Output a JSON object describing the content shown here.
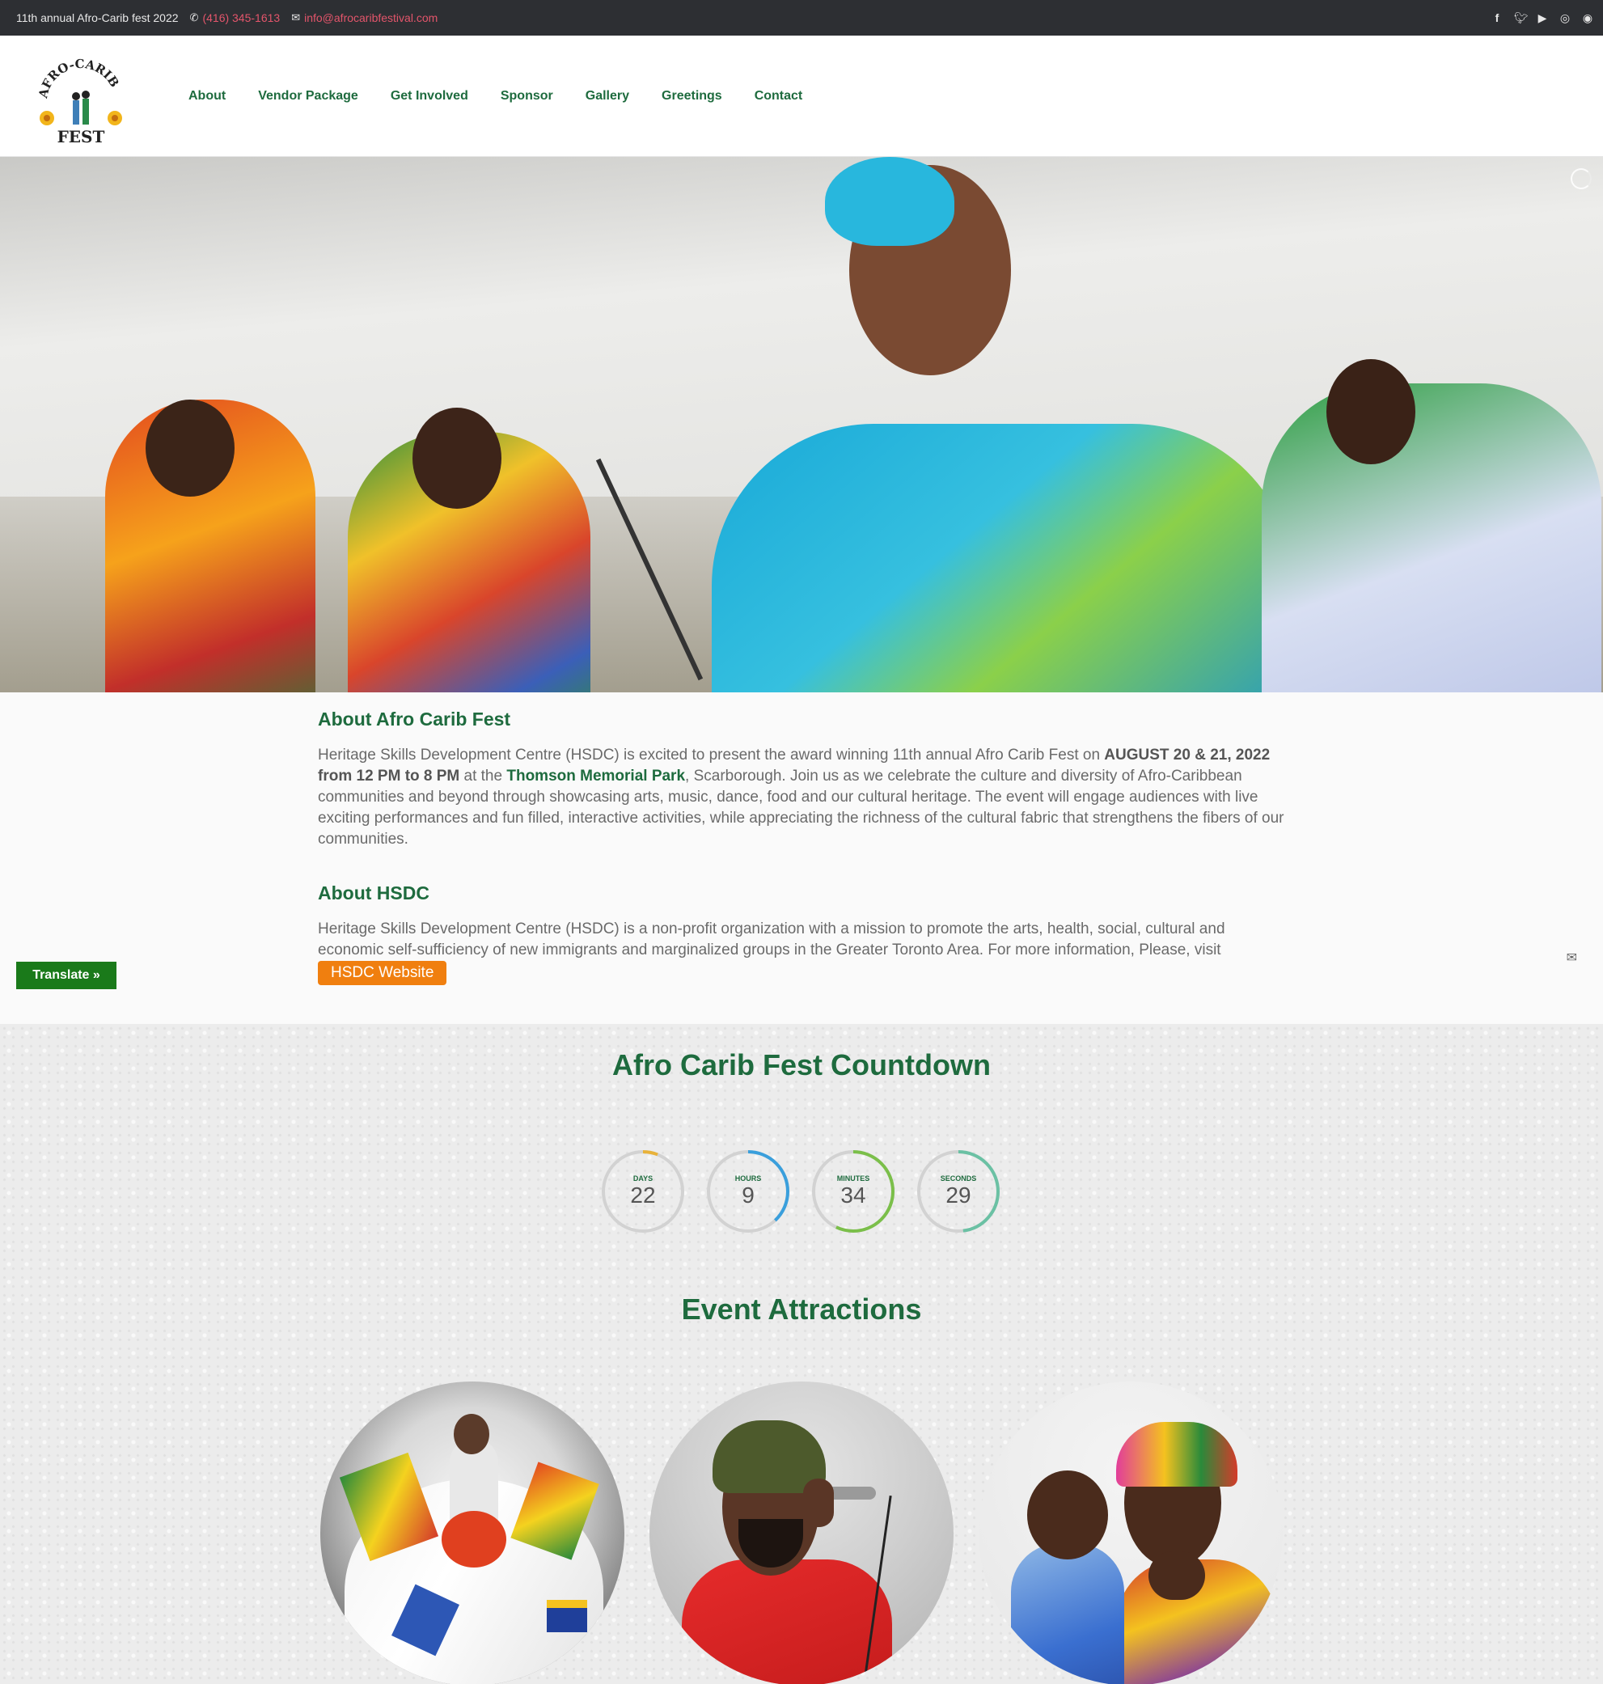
{
  "topbar": {
    "tagline": "11th annual Afro-Carib fest 2022",
    "phone": "(416) 345-1613",
    "email": "info@afrocaribfestival.com",
    "socials": [
      "facebook-icon",
      "twitter-icon",
      "youtube-icon",
      "instagram-icon",
      "globe-icon"
    ]
  },
  "logo": {
    "text_top": "AFRO-CARIB",
    "text_bottom": "FEST"
  },
  "nav": {
    "items": [
      "About",
      "Vendor Package",
      "Get Involved",
      "Sponsor",
      "Gallery",
      "Greetings",
      "Contact"
    ]
  },
  "hero": {
    "slide_count": 11,
    "active_slide": 7
  },
  "about": {
    "title": "About Afro Carib Fest",
    "p1_a": "Heritage Skills Development Centre (HSDC) is excited to present the award winning 11th annual Afro Carib Fest on ",
    "p1_date": "AUGUST 20 & 21, 2022 from 12 PM to 8 PM",
    "p1_b": " at the ",
    "p1_park": "Thomson Memorial Park",
    "p1_c": ", Scarborough. Join us as we celebrate the culture and diversity of Afro-Caribbean communities and beyond through showcasing arts, music, dance, food and our cultural heritage. The event will engage audiences with live exciting performances and fun filled, interactive activities, while appreciating the richness of the cultural fabric that strengthens the fibers of our communities.",
    "hsdc_title": "About HSDC",
    "p2": "Heritage Skills Development Centre (HSDC) is a non-profit organization with a mission to promote the arts, health, social, cultural and economic self-sufficiency of new immigrants and marginalized groups in the Greater Toronto Area. For more information, Please, visit ",
    "hsdc_button": "HSDC Website"
  },
  "translate": {
    "label": "Translate »"
  },
  "countdown": {
    "title": "Afro Carib Fest Countdown",
    "timers": [
      {
        "label": "DAYS",
        "value": "22",
        "color": "#e8b23a",
        "fraction": 0.06
      },
      {
        "label": "HOURS",
        "value": "9",
        "color": "#3a9fdc",
        "fraction": 0.38
      },
      {
        "label": "MINUTES",
        "value": "34",
        "color": "#7bbf4a",
        "fraction": 0.57
      },
      {
        "label": "SECONDS",
        "value": "29",
        "color": "#6bc1a4",
        "fraction": 0.48
      }
    ]
  },
  "attractions": {
    "title": "Event Attractions"
  },
  "colors": {
    "brand_green": "#1e6b3e",
    "accent_orange": "#f07f0f",
    "topbar_link": "#e3556b"
  }
}
